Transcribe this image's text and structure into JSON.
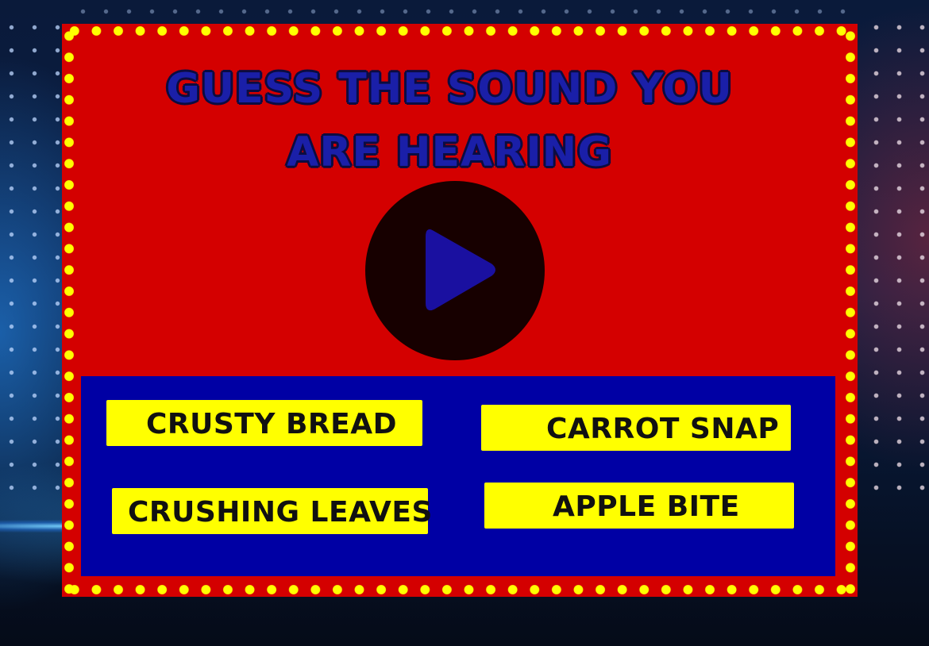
{
  "game": {
    "question": "GUESS THE SOUND YOU ARE HEARING",
    "play_button_icon": "play-icon",
    "answers": [
      {
        "label": "CRUSTY BREAD"
      },
      {
        "label": "CARROT SNAP"
      },
      {
        "label": "CRUSHING LEAVES"
      },
      {
        "label": "APPLE BITE"
      }
    ]
  },
  "colors": {
    "background": "#0b1f45",
    "board": "#d40000",
    "bulbs": "#ffff00",
    "title_text": "#1a1fa8",
    "play_button": "#170000",
    "play_icon": "#1a10a0",
    "answer_panel": "#0000a4",
    "answer_button": "#ffff00",
    "answer_text": "#111111"
  }
}
